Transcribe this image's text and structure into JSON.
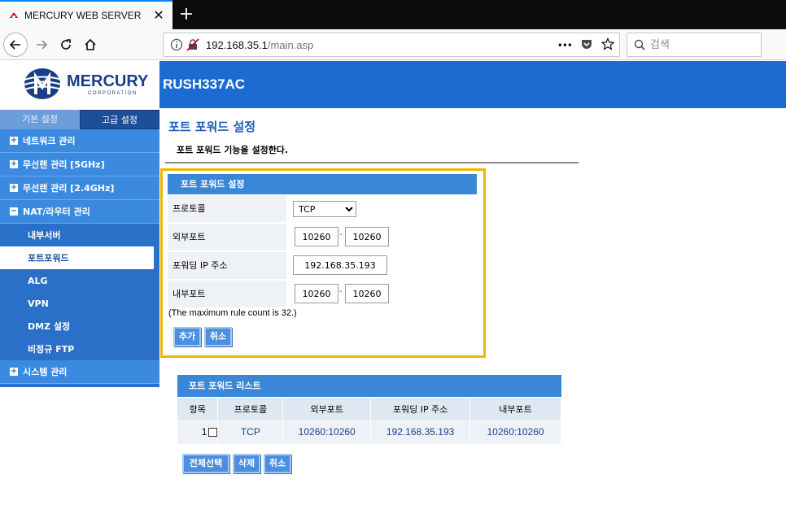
{
  "browser": {
    "tab_title": "MERCURY WEB SERVER",
    "tab_close": "✕",
    "new_tab": "+",
    "url_host": "192.168.35.1",
    "url_path": "/main.asp",
    "more_actions": "•••",
    "search_placeholder": "검색"
  },
  "brand": {
    "logo_text": "MERCURY",
    "logo_sub": "CORPORATION",
    "model": "RUSH337AC",
    "accent": "#1b6bd1",
    "highlight": "#f0b400"
  },
  "sidebar": {
    "tabs": [
      "기본 설정",
      "고급 설정"
    ],
    "groups": [
      {
        "label": "네트워크 관리"
      },
      {
        "label": "무선랜 관리 [5GHz]"
      },
      {
        "label": "무선랜 관리 [2.4GHz]"
      },
      {
        "label": "NAT/라우터 관리"
      }
    ],
    "sub_items": [
      "내부서버",
      "포트포워드",
      "ALG",
      "VPN",
      "DMZ 설정",
      "비정규 FTP"
    ],
    "last_group": "시스템 관리",
    "expand_sign": "+",
    "collapse_sign": "−"
  },
  "content": {
    "title": "포트 포워드 설정",
    "description": "포트 포워드 기능을 설정한다."
  },
  "form": {
    "header": "포트 포워드 설정",
    "protocol_label": "프로토콜",
    "protocol_value": "TCP",
    "ext_port_label": "외부포트",
    "ext_port_start": "10260",
    "ext_port_end": "10260",
    "fwd_ip_label": "포워딩 IP 주소",
    "fwd_ip": "192.168.35.193",
    "int_port_label": "내부포트",
    "int_port_start": "10260",
    "int_port_end": "10260",
    "dash": "-",
    "max_note": "(The maximum rule count is 32.)",
    "add_button": "추가",
    "cancel_button": "취소"
  },
  "list": {
    "header": "포트 포워드 리스트",
    "columns": [
      "항목",
      "프로토콜",
      "외부포트",
      "포워딩 IP 주소",
      "내부포트"
    ],
    "rows": [
      {
        "index": "1",
        "protocol": "TCP",
        "ext_port": "10260:10260",
        "ip": "192.168.35.193",
        "int_port": "10260:10260"
      }
    ],
    "select_all_button": "전체선택",
    "delete_button": "삭제",
    "cancel_button": "취소"
  }
}
